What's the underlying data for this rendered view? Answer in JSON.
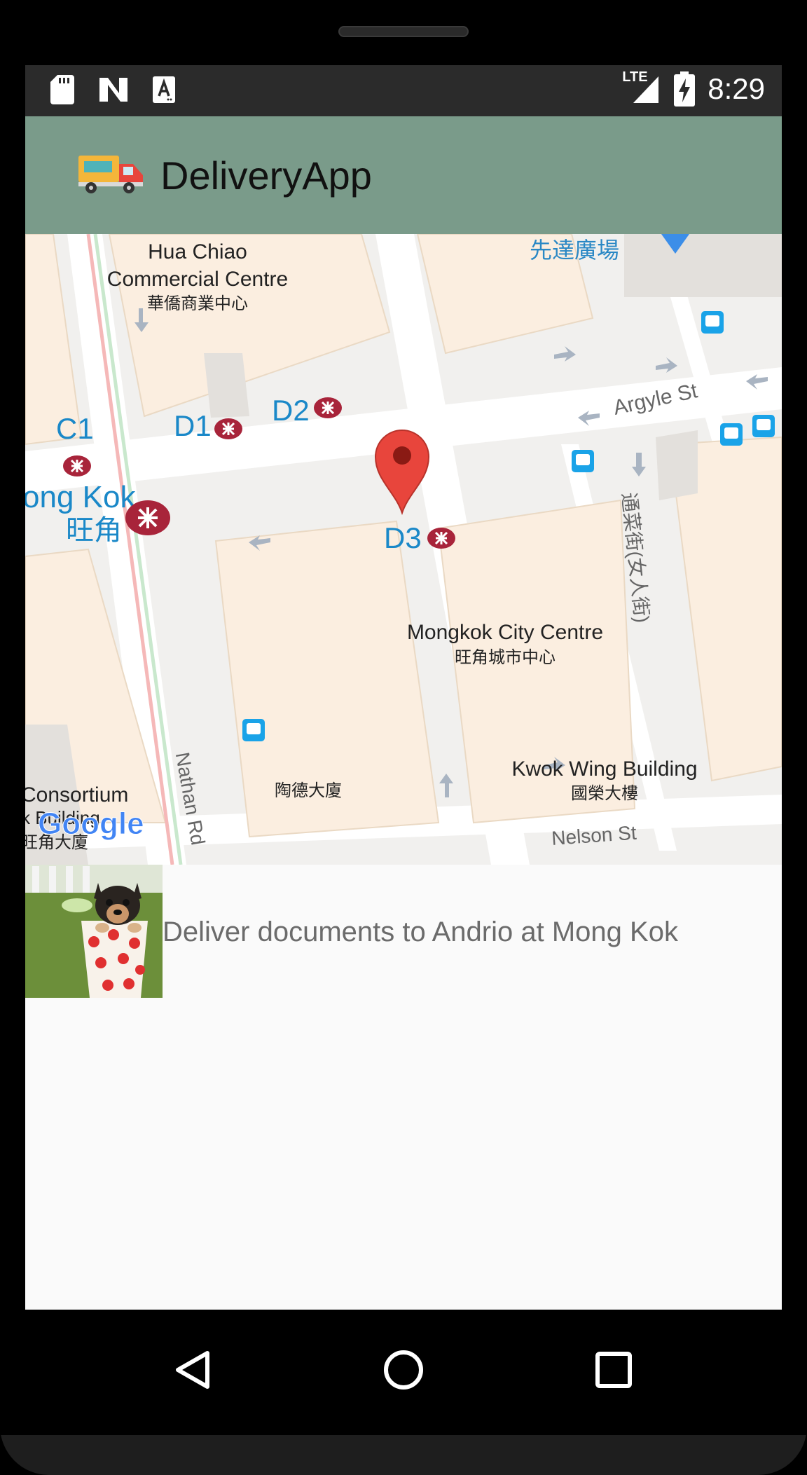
{
  "status_bar": {
    "time": "8:29",
    "network_label": "LTE",
    "left_icons": [
      "sd-card-icon",
      "n-logo-icon",
      "a-notification-icon"
    ],
    "right_icons": [
      "signal-icon",
      "battery-charging-icon"
    ]
  },
  "app_bar": {
    "title": "DeliveryApp",
    "logo_icon": "truck-icon"
  },
  "map": {
    "labels": {
      "hua_chiao_1": "Hua Chiao",
      "hua_chiao_2": "Commercial Centre",
      "hua_chiao_zh": "華僑商業中心",
      "sin_tat": "先達廣場",
      "argyle": "Argyle St",
      "exit_c1": "C1",
      "exit_d1": "D1",
      "exit_d2": "D2",
      "exit_d3": "D3",
      "mong_kok_en": "ong Kok",
      "mong_kok_zh": "旺角",
      "tung_choi": "通菜街(女人街)",
      "mongkok_city_centre": "Mongkok City Centre",
      "mongkok_city_centre_zh": "旺角城市中心",
      "kwok_wing": "Kwok Wing Building",
      "kwok_wing_zh": "國榮大樓",
      "to_tak": "陶德大廈",
      "nathan": "Nathan Rd",
      "nelson": "Nelson St",
      "consortium": "Consortium",
      "consortium_2": "k Building",
      "consortium_zh": "旺角大廈",
      "google": "Google"
    },
    "marker_icon": "map-pin-icon",
    "mtr_icon": "mtr-logo-icon",
    "bus_icon": "bus-stop-icon"
  },
  "list": {
    "items": [
      {
        "text": "Deliver documents to Andrio at Mong Kok",
        "image": "puppy-in-cup-image"
      }
    ]
  },
  "nav_bar": {
    "back_icon": "back-triangle-icon",
    "home_icon": "home-circle-icon",
    "recents_icon": "recents-square-icon"
  },
  "colors": {
    "app_bar": "#7a9b8a",
    "status_bar": "#2b2b2b",
    "map_exit_label": "#1a88c8",
    "mtr_red": "#a8243a",
    "marker_red": "#e8453c"
  }
}
